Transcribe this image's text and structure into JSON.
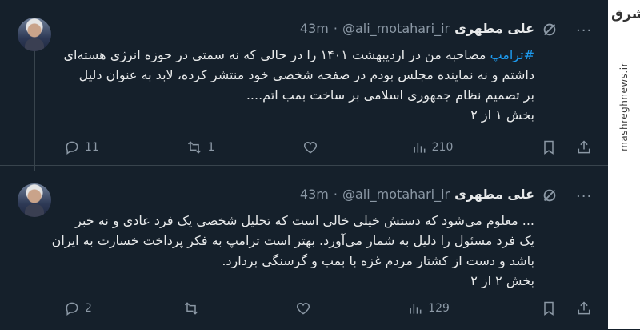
{
  "tweets": [
    {
      "author_name": "علی مطهری",
      "handle": "@ali_motahari_ir",
      "separator": "·",
      "time": "43m",
      "hashtag": "#ترامپ",
      "lines": [
        "مصاحبه من در اردیبهشت ۱۴۰۱ را در حالی که نه سمتی در حوزه انرژی هسته‌ای",
        "داشتم و نه نماینده مجلس بودم در صفحه شخصی خود منتشر کرده، لابد به عنوان دلیل",
        "بر تصمیم نظام جمهوری اسلامی بر ساخت بمب اتم....",
        "بخش ۱ از ۲"
      ],
      "replies": "11",
      "reposts": "1",
      "likes": "",
      "views": "210"
    },
    {
      "author_name": "علی مطهری",
      "handle": "@ali_motahari_ir",
      "separator": "·",
      "time": "43m",
      "hashtag": "",
      "lines": [
        "... معلوم می‌شود که دستش خیلی خالی است که تحلیل شخصی یک فرد عادی و نه خبر",
        "یک فرد مسئول را دلیل به شمار می‌آورد. بهتر است ترامپ به فکر پرداخت خسارت به ایران",
        "باشد و دست از کشتار مردم غزه با بمب و گرسنگی بردارد.",
        "بخش ۲ از ۲"
      ],
      "replies": "2",
      "reposts": "",
      "likes": "",
      "views": "129"
    }
  ],
  "watermark": {
    "logo_text": "مشرق",
    "site": "mashreghnews.ir"
  },
  "icons": {
    "reply": "reply-icon",
    "repost": "repost-icon",
    "like": "heart-icon",
    "views": "views-icon",
    "bookmark": "bookmark-icon",
    "share": "share-icon",
    "grok": "grok-icon",
    "more": "more-icon"
  },
  "colors": {
    "background": "#15202b",
    "hashtag": "#1d9bf0",
    "secondary_text": "#8b98a5"
  }
}
